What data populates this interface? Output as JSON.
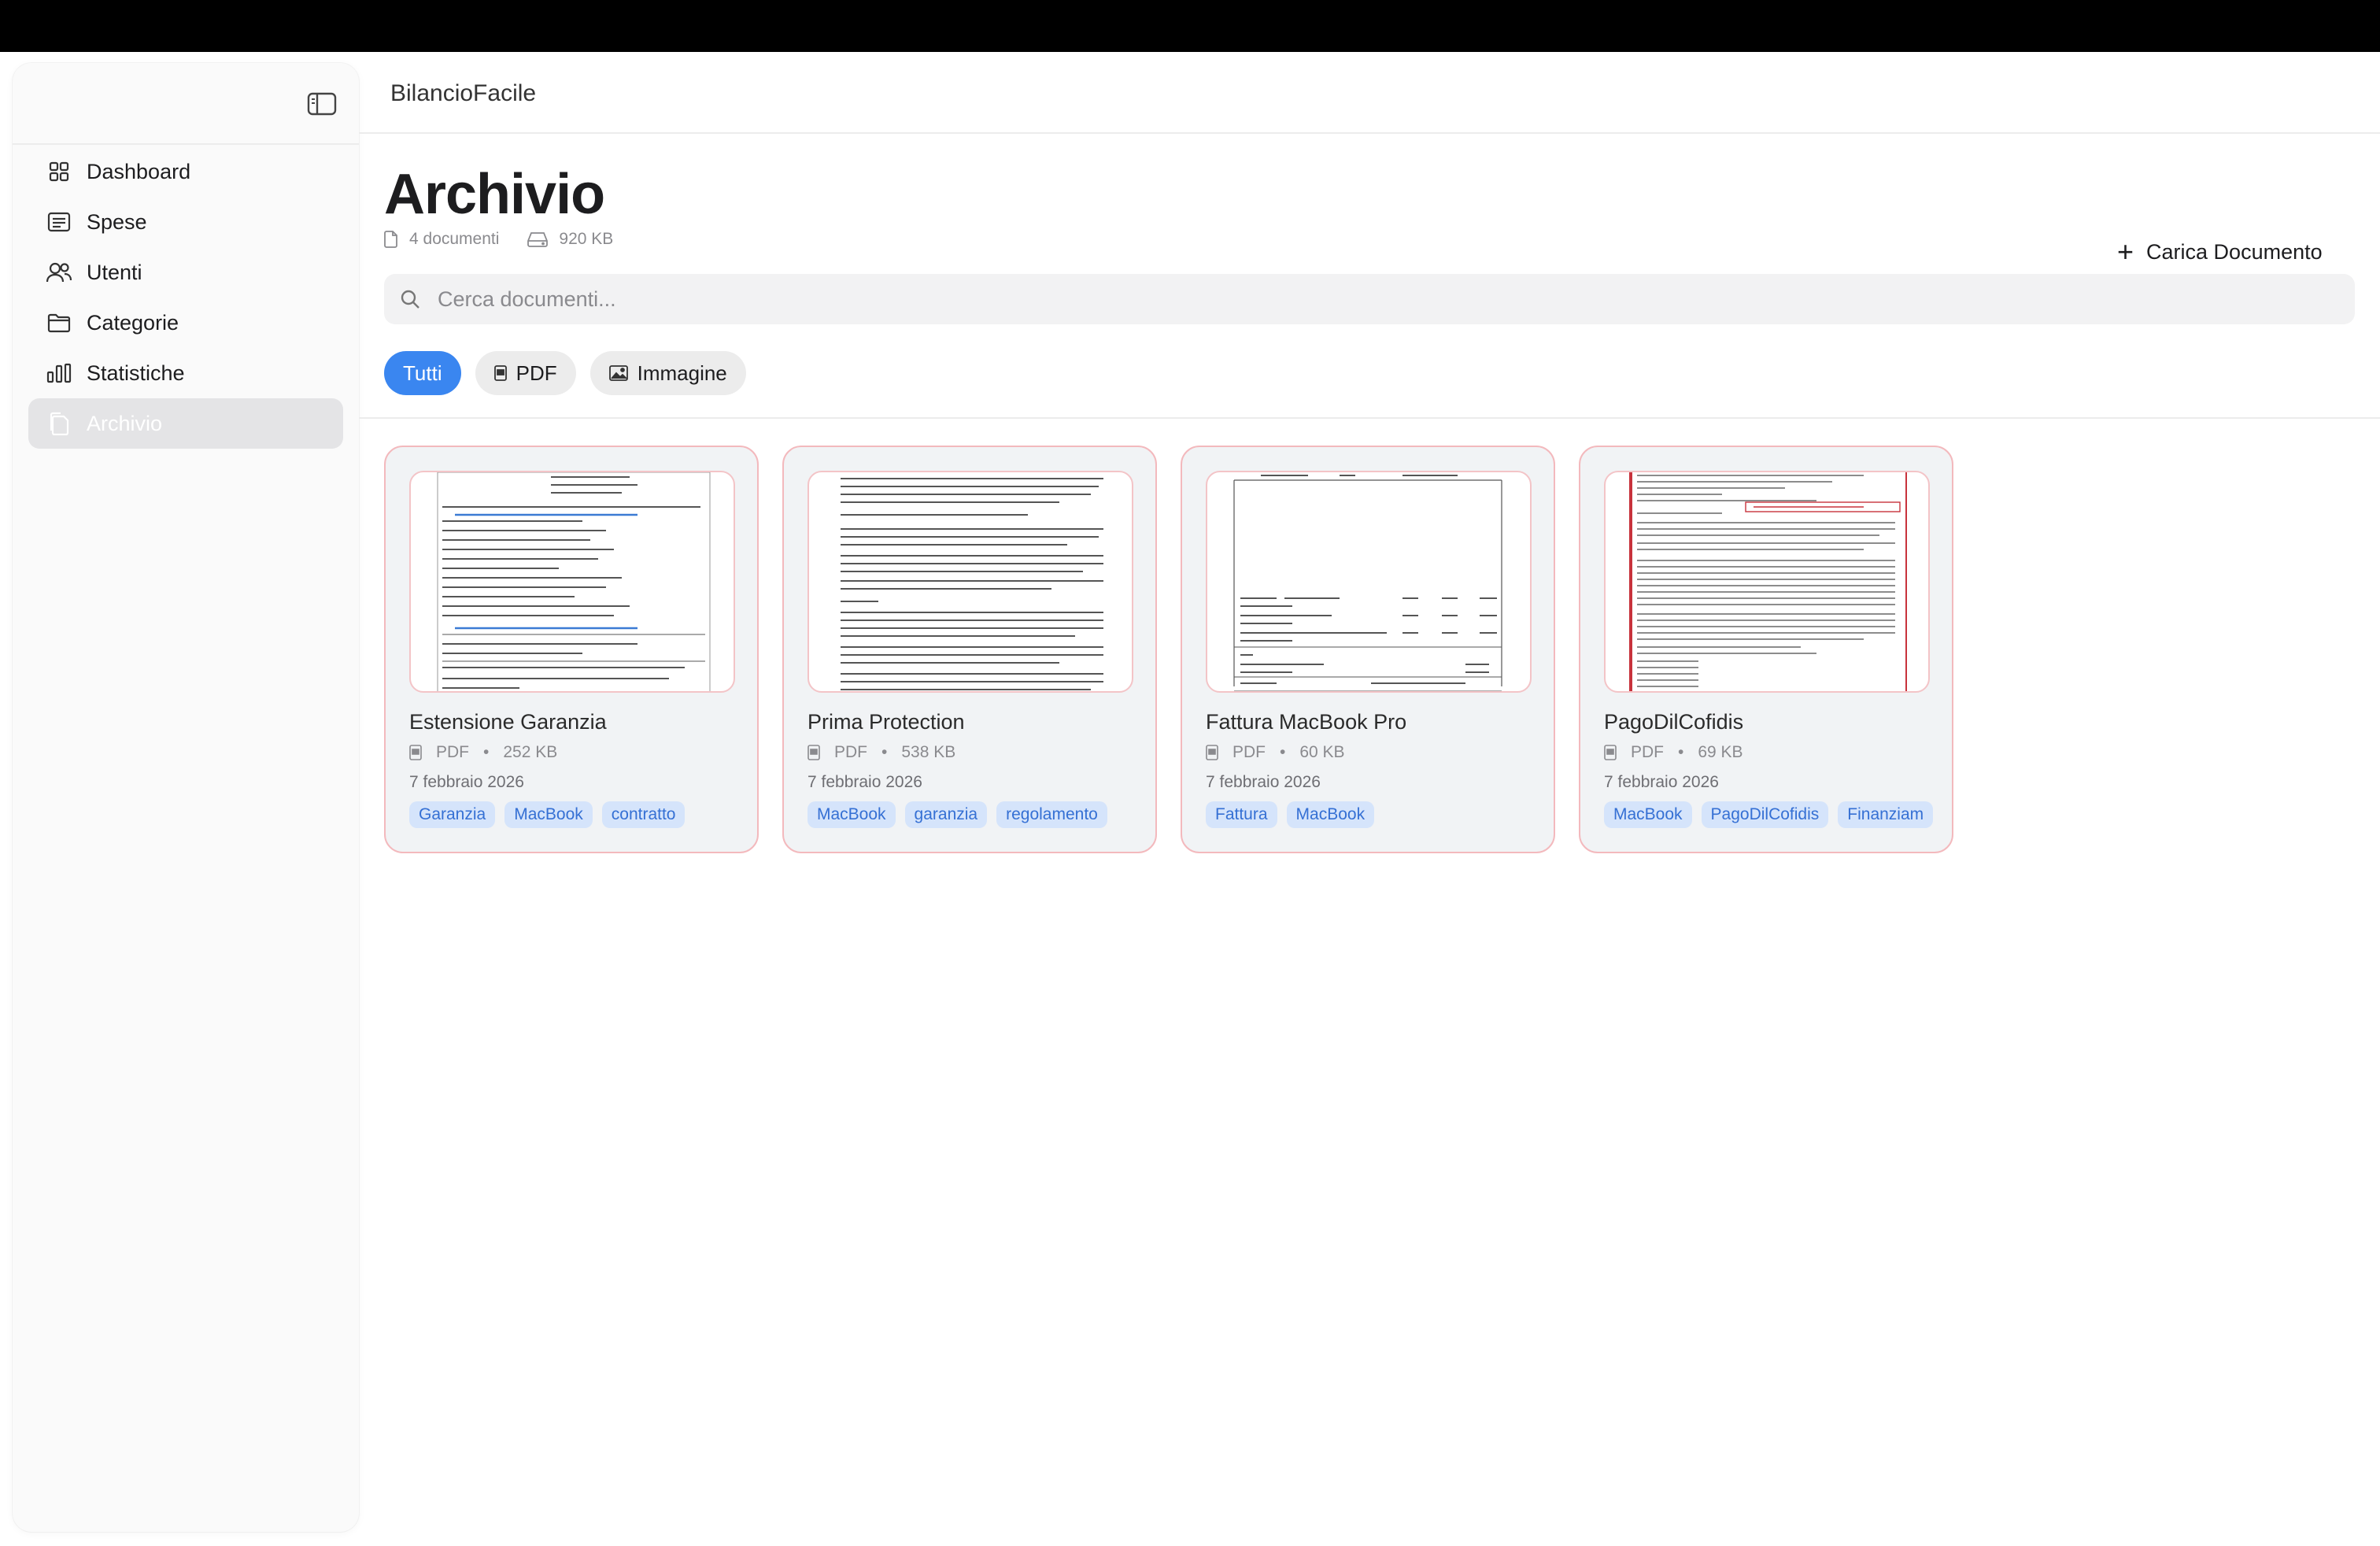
{
  "app": {
    "title": "BilancioFacile"
  },
  "sidebar": {
    "items": [
      {
        "label": "Dashboard",
        "icon": "grid-icon"
      },
      {
        "label": "Spese",
        "icon": "list-icon"
      },
      {
        "label": "Utenti",
        "icon": "users-icon"
      },
      {
        "label": "Categorie",
        "icon": "folder-icon"
      },
      {
        "label": "Statistiche",
        "icon": "bar-chart-icon"
      },
      {
        "label": "Archivio",
        "icon": "documents-icon",
        "active": true
      }
    ]
  },
  "page": {
    "title": "Archivio",
    "doc_count": "4 documenti",
    "total_size": "920 KB",
    "upload_label": "Carica Documento"
  },
  "search": {
    "placeholder": "Cerca documenti..."
  },
  "filters": [
    {
      "label": "Tutti",
      "active": true
    },
    {
      "label": "PDF",
      "active": false
    },
    {
      "label": "Immagine",
      "active": false
    }
  ],
  "documents": [
    {
      "title": "Estensione Garanzia",
      "type": "PDF",
      "size": "252 KB",
      "date": "7 febbraio 2026",
      "tags": [
        "Garanzia",
        "MacBook",
        "contratto"
      ]
    },
    {
      "title": "Prima Protection",
      "type": "PDF",
      "size": "538 KB",
      "date": "7 febbraio 2026",
      "tags": [
        "MacBook",
        "garanzia",
        "regolamento"
      ]
    },
    {
      "title": "Fattura MacBook Pro",
      "type": "PDF",
      "size": "60 KB",
      "date": "7 febbraio 2026",
      "tags": [
        "Fattura",
        "MacBook"
      ]
    },
    {
      "title": "PagoDilCofidis",
      "type": "PDF",
      "size": "69 KB",
      "date": "7 febbraio 2026",
      "tags": [
        "MacBook",
        "PagoDilCofidis",
        "Finanziam"
      ]
    }
  ],
  "colors": {
    "accent": "#3a86f0",
    "card_border": "#f3b9bd",
    "tag_bg": "#d5e4fb",
    "tag_text": "#3570d4"
  }
}
